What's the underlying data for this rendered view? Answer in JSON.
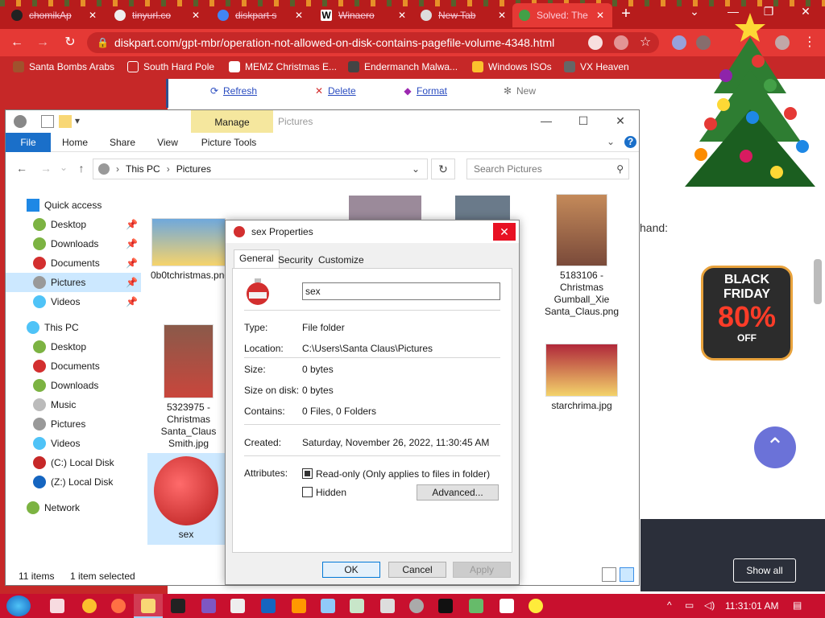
{
  "browser": {
    "tabs": [
      {
        "label": "chomikAp"
      },
      {
        "label": "tinyurl.co"
      },
      {
        "label": "diskpart s"
      },
      {
        "label": "Winaero"
      },
      {
        "label": "New Tab"
      },
      {
        "label": "Solved: The"
      }
    ],
    "new_tab": "+",
    "url": "diskpart.com/gpt-mbr/operation-not-allowed-on-disk-contains-pagefile-volume-4348.html",
    "bookmarks": [
      {
        "label": "Santa Bombs Arabs"
      },
      {
        "label": "South Hard Pole"
      },
      {
        "label": "MEMZ Christmas E..."
      },
      {
        "label": "Endermanch Malwa..."
      },
      {
        "label": "Windows ISOs"
      },
      {
        "label": "VX Heaven"
      }
    ]
  },
  "webpage": {
    "toolbar": [
      {
        "label": "Refresh"
      },
      {
        "label": "Delete"
      },
      {
        "label": "Format"
      },
      {
        "label": "New"
      }
    ],
    "partial_text": "hand:",
    "promo": {
      "line1": "BLACK",
      "line2": "FRIDAY",
      "percent": "80%",
      "off": "OFF"
    },
    "show_all": "Show all"
  },
  "explorer": {
    "context_tab": "Manage",
    "title": "Pictures",
    "ribbon_tabs": [
      {
        "label": "File"
      },
      {
        "label": "Home"
      },
      {
        "label": "Share"
      },
      {
        "label": "View"
      },
      {
        "label": "Picture Tools"
      }
    ],
    "breadcrumb": [
      "This PC",
      "Pictures"
    ],
    "search_placeholder": "Search Pictures",
    "nav": {
      "quick_access": "Quick access",
      "quick_items": [
        {
          "label": "Desktop"
        },
        {
          "label": "Downloads"
        },
        {
          "label": "Documents"
        },
        {
          "label": "Pictures"
        },
        {
          "label": "Videos"
        }
      ],
      "this_pc": "This PC",
      "pc_items": [
        {
          "label": "Desktop"
        },
        {
          "label": "Documents"
        },
        {
          "label": "Downloads"
        },
        {
          "label": "Music"
        },
        {
          "label": "Pictures"
        },
        {
          "label": "Videos"
        },
        {
          "label": "(C:) Local Disk"
        },
        {
          "label": "(Z:) Local Disk"
        }
      ],
      "network": "Network"
    },
    "files": [
      {
        "name": "0b0tchristmas.png"
      },
      {
        "name": "5323975 - Christmas Santa_Claus Smith.jpg"
      },
      {
        "name": "sex"
      },
      {
        "name": "5183106 - Christmas Gumball_Xie Santa_Claus.png"
      },
      {
        "name": "starchrima.jpg"
      }
    ],
    "status": {
      "count": "11 items",
      "selected": "1 item selected"
    }
  },
  "dialog": {
    "title": "sex Properties",
    "tabs": [
      {
        "label": "General"
      },
      {
        "label": "Security"
      },
      {
        "label": "Customize"
      }
    ],
    "name": "sex",
    "props": {
      "type_label": "Type:",
      "type_value": "File folder",
      "location_label": "Location:",
      "location_value": "C:\\Users\\Santa Claus\\Pictures",
      "size_label": "Size:",
      "size_value": "0 bytes",
      "size_on_disk_label": "Size on disk:",
      "size_on_disk_value": "0 bytes",
      "contains_label": "Contains:",
      "contains_value": "0 Files, 0 Folders",
      "created_label": "Created:",
      "created_value": "Saturday, November 26, 2022, 11:30:45 AM",
      "attributes_label": "Attributes:"
    },
    "readonly_label": "Read-only (Only applies to files in folder)",
    "hidden_label": "Hidden",
    "advanced_label": "Advanced...",
    "buttons": {
      "ok": "OK",
      "cancel": "Cancel",
      "apply": "Apply"
    }
  },
  "taskbar": {
    "time": "11:31:01 AM"
  }
}
